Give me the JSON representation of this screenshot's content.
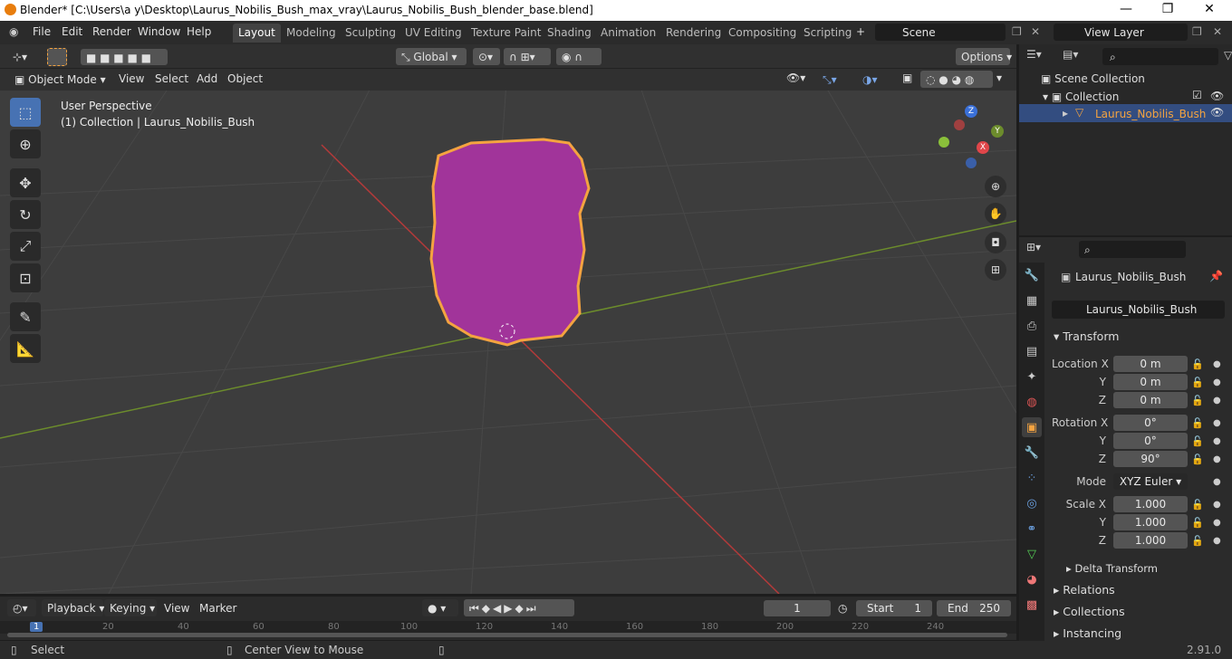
{
  "window": {
    "title": "Blender* [C:\\Users\\a y\\Desktop\\Laurus_Nobilis_Bush_max_vray\\Laurus_Nobilis_Bush_blender_base.blend]",
    "minimize": "—",
    "maximize": "❐",
    "close": "✕"
  },
  "menu": [
    "File",
    "Edit",
    "Render",
    "Window",
    "Help"
  ],
  "workspaces": [
    "Layout",
    "Modeling",
    "Sculpting",
    "UV Editing",
    "Texture Paint",
    "Shading",
    "Animation",
    "Rendering",
    "Compositing",
    "Scripting"
  ],
  "scene": {
    "name": "Scene",
    "view_layer": "View Layer"
  },
  "viewport_header": {
    "transform_orientation": "Global",
    "options": "Options",
    "mode": "Object Mode",
    "menus": [
      "View",
      "Select",
      "Add",
      "Object"
    ]
  },
  "viewport": {
    "perspective": "User Perspective",
    "collection_info": "(1) Collection | Laurus_Nobilis_Bush",
    "gizmo": {
      "z": "Z",
      "y": "Y",
      "x": "X"
    },
    "grid_color": "#484848",
    "x_axis_color": "#b33a3a",
    "y_axis_color": "#6c8c2c",
    "object_color": "#a1349a",
    "selection_color": "#f4a340"
  },
  "outliner": {
    "scene_collection": "Scene Collection",
    "collection": "Collection",
    "object": "Laurus_Nobilis_Bush"
  },
  "properties": {
    "object_name": "Laurus_Nobilis_Bush",
    "data_name": "Laurus_Nobilis_Bush",
    "transform_label": "Transform",
    "location": {
      "label_x": "Location X",
      "label_y": "Y",
      "label_z": "Z",
      "x": "0 m",
      "y": "0 m",
      "z": "0 m"
    },
    "rotation": {
      "label_x": "Rotation X",
      "label_y": "Y",
      "label_z": "Z",
      "x": "0°",
      "y": "0°",
      "z": "90°"
    },
    "mode": {
      "label": "Mode",
      "value": "XYZ Euler"
    },
    "scale": {
      "label_x": "Scale X",
      "label_y": "Y",
      "label_z": "Z",
      "x": "1.000",
      "y": "1.000",
      "z": "1.000"
    },
    "delta_transform": "Delta Transform",
    "sections": [
      "Relations",
      "Collections",
      "Instancing"
    ]
  },
  "timeline": {
    "menus": [
      "Playback",
      "Keying",
      "View",
      "Marker"
    ],
    "current_frame": "1",
    "start_label": "Start",
    "start": "1",
    "end_label": "End",
    "end": "250",
    "ruler": [
      "1",
      "20",
      "40",
      "60",
      "80",
      "100",
      "120",
      "140",
      "160",
      "180",
      "200",
      "220",
      "240"
    ]
  },
  "statusbar": {
    "left": "Select",
    "middle": "Center View to Mouse",
    "version": "2.91.0"
  }
}
